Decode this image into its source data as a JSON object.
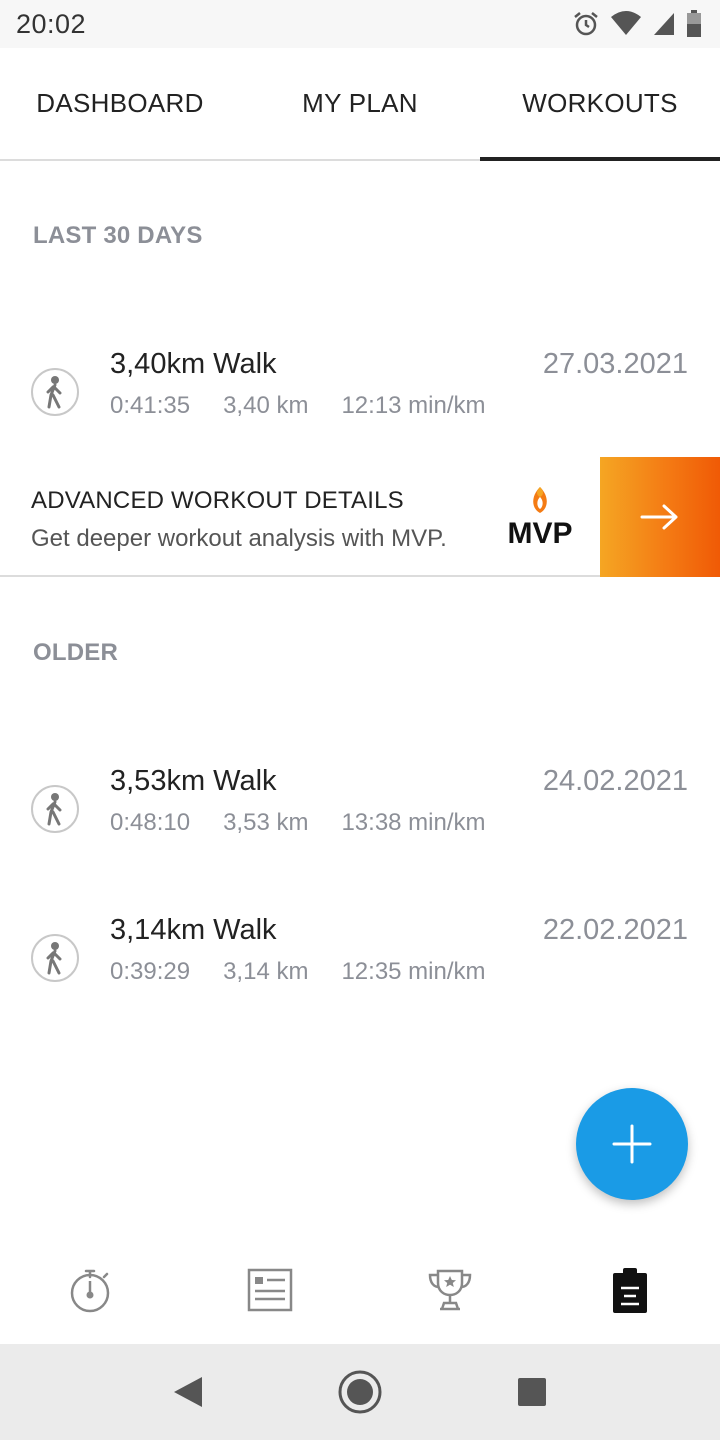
{
  "status_bar": {
    "time": "20:02",
    "icons": [
      "alarm-icon",
      "wifi-icon",
      "signal-icon",
      "battery-icon"
    ]
  },
  "tabs": [
    {
      "label": "DASHBOARD",
      "active": false
    },
    {
      "label": "MY PLAN",
      "active": false
    },
    {
      "label": "WORKOUTS",
      "active": true
    }
  ],
  "sections": {
    "recent": "LAST 30 DAYS",
    "older": "OLDER"
  },
  "workouts": [
    {
      "title": "3,40km Walk",
      "date": "27.03.2021",
      "duration": "0:41:35",
      "distance": "3,40 km",
      "pace": "12:13 min/km",
      "icon": "walk-icon"
    },
    {
      "title": "3,53km Walk",
      "date": "24.02.2021",
      "duration": "0:48:10",
      "distance": "3,53 km",
      "pace": "13:38 min/km",
      "icon": "walk-icon"
    },
    {
      "title": "3,14km Walk",
      "date": "22.02.2021",
      "duration": "0:39:29",
      "distance": "3,14 km",
      "pace": "12:35 min/km",
      "icon": "walk-icon"
    }
  ],
  "mvp_banner": {
    "title": "ADVANCED WORKOUT DETAILS",
    "subtitle": "Get deeper workout analysis with MVP.",
    "logo_text": "MVP",
    "arrow_icon": "arrow-right-icon"
  },
  "fab": {
    "icon": "plus-icon"
  },
  "bottom_nav": [
    {
      "icon": "stopwatch-icon",
      "active": false
    },
    {
      "icon": "news-feed-icon",
      "active": false
    },
    {
      "icon": "trophy-icon",
      "active": false
    },
    {
      "icon": "clipboard-icon",
      "active": true
    }
  ],
  "system_nav": [
    "back-icon",
    "home-icon",
    "recents-icon"
  ],
  "colors": {
    "accent": "#1a9be6",
    "mvp_gradient_start": "#f5a623",
    "mvp_gradient_end": "#f05a06",
    "muted_text": "#8c8f97"
  }
}
